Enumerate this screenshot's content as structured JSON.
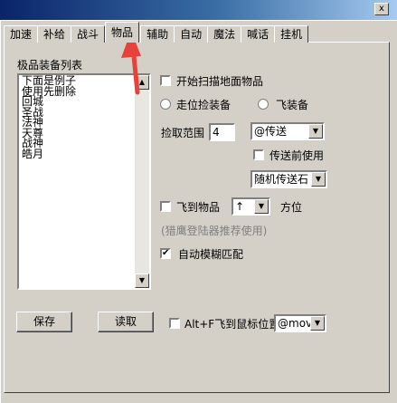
{
  "window": {
    "close_glyph": "x"
  },
  "tabs": [
    {
      "label": "加速",
      "active": false
    },
    {
      "label": "补给",
      "active": false
    },
    {
      "label": "战斗",
      "active": false
    },
    {
      "label": "物品",
      "active": true
    },
    {
      "label": "辅助",
      "active": false
    },
    {
      "label": "自动",
      "active": false
    },
    {
      "label": "魔法",
      "active": false
    },
    {
      "label": "喊话",
      "active": false
    },
    {
      "label": "挂机",
      "active": false
    }
  ],
  "list": {
    "title": "极品装备列表",
    "items": [
      "下面是例子",
      "使用先删除",
      "回城",
      "圣战",
      "法神",
      "天尊",
      "战神",
      "皓月"
    ]
  },
  "options": {
    "scan_ground_label": "开始扫描地面物品",
    "scan_ground_checked": false,
    "walk_pick_label": "走位捡装备",
    "walk_pick_selected": false,
    "fly_pick_label": "飞装备",
    "fly_pick_selected": false,
    "pick_range_label": "捡取范围",
    "pick_range_value": "4",
    "teleport_select": "@传送",
    "teleport_before_label": "传送前使用",
    "teleport_before_checked": false,
    "teleport_item_select": "随机传送石",
    "fly_to_item_label": "飞到物品",
    "fly_to_item_checked": false,
    "direction_select": "↑",
    "direction_label": "方位",
    "hint": "(猎鹰登陆器推荐使用)",
    "fuzzy_match_label": "自动模糊匹配",
    "fuzzy_match_checked": true
  },
  "footer": {
    "save_label": "保存",
    "read_label": "读取",
    "altf_label": "Alt+F飞到鼠标位置",
    "altf_checked": false,
    "move_select": "@move"
  },
  "colors": {
    "annotation_arrow": "#e8403a",
    "title_gradient_start": "#0a246a",
    "title_gradient_end": "#a6caf0"
  },
  "icons": {
    "dropdown": "triangle-down",
    "scroll_up": "triangle-up",
    "scroll_down": "triangle-down",
    "check": "check-mark"
  }
}
